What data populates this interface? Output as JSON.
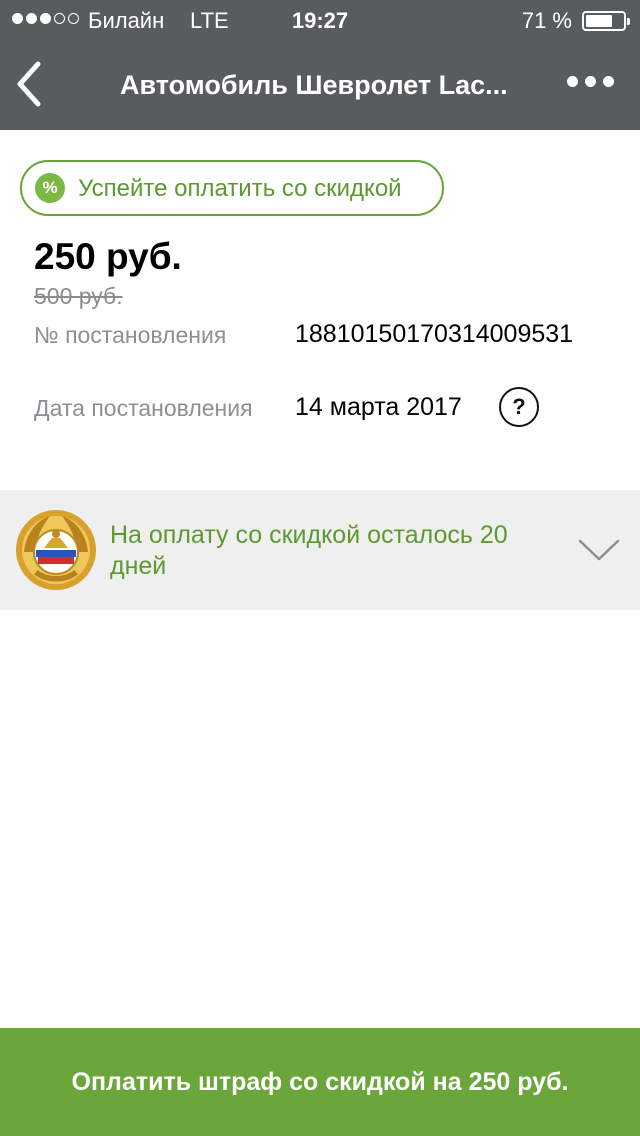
{
  "status_bar": {
    "signal_dots_filled": 3,
    "signal_dots_total": 5,
    "carrier": "Билайн",
    "network": "LTE",
    "time": "19:27",
    "battery_percent": "71 %",
    "battery_level": 0.71
  },
  "nav": {
    "title": "Автомобиль Шевролет Lac...",
    "back_icon": "chevron-left-icon",
    "more_icon": "more-horizontal-icon"
  },
  "discount_badge": {
    "icon": "percent-icon",
    "icon_glyph": "%",
    "label": "Успейте оплатить со скидкой"
  },
  "fine": {
    "amount": "250 руб.",
    "old_amount": "500 руб.",
    "resolution_number_label": "№ постановления",
    "resolution_number": "18810150170314009531",
    "resolution_date_label": "Дата постановления",
    "resolution_date": "14 марта 2017",
    "help_glyph": "?"
  },
  "countdown": {
    "emblem": "gibdd-emblem",
    "text": "На оплату со скидкой осталось 20 дней",
    "chevron_icon": "chevron-down-icon"
  },
  "pay_button": {
    "label": "Оплатить штраф со скидкой на 250 руб."
  },
  "colors": {
    "header_bg": "#575c5f",
    "accent_green": "#6ba63a",
    "green_text": "#5c9a30",
    "gray_label": "#8e8e93",
    "countdown_bg": "#efefef"
  }
}
